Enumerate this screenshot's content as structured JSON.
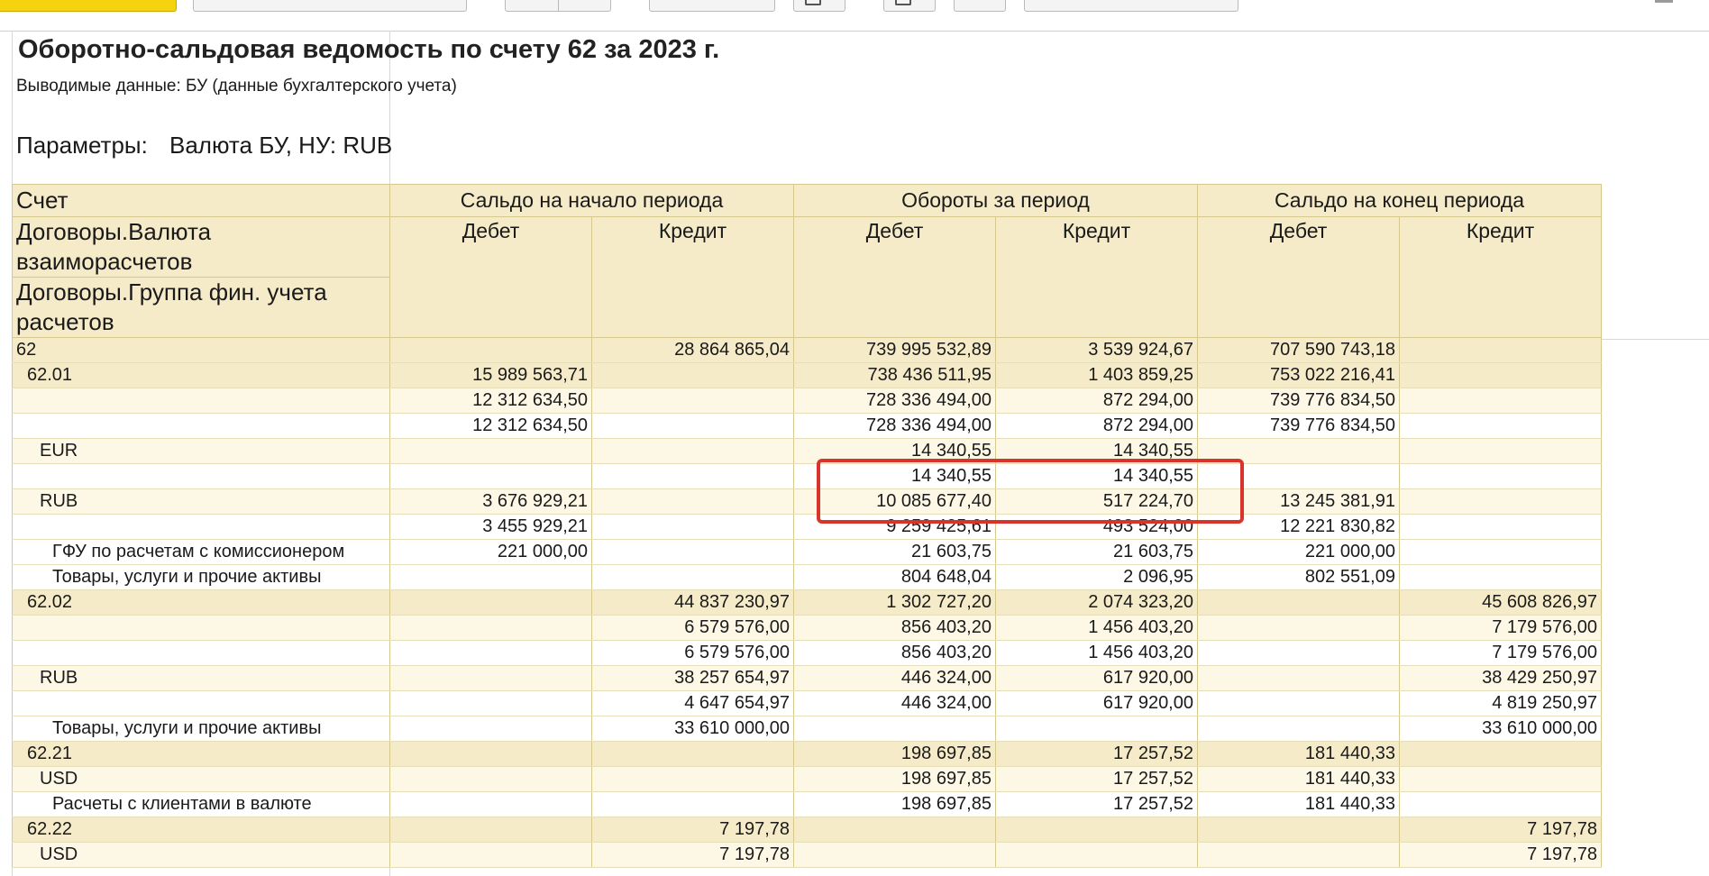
{
  "report": {
    "title": "Оборотно-сальдовая ведомость по счету 62 за 2023 г.",
    "subtitle": "Выводимые данные: БУ (данные бухгалтерского учета)",
    "params_label": "Параметры:",
    "params_value": "Валюта БУ, НУ: RUB"
  },
  "table": {
    "col_account": "Счет",
    "group_labels": [
      "Договоры.Валюта взаиморасчетов",
      "Договоры.Группа фин. учета расчетов"
    ],
    "col_opening": "Сальдо на начало периода",
    "col_turnover": "Обороты за период",
    "col_closing": "Сальдо на конец периода",
    "debit": "Дебет",
    "credit": "Кредит",
    "rows": [
      {
        "label": "62",
        "open_d": "",
        "open_c": "28 864 865,04",
        "turn_d": "739 995 532,89",
        "turn_c": "3 539 924,67",
        "close_d": "707 590 743,18",
        "close_c": ""
      },
      {
        "label": "62.01",
        "open_d": "15 989 563,71",
        "open_c": "",
        "turn_d": "738 436 511,95",
        "turn_c": "1 403 859,25",
        "close_d": "753 022 216,41",
        "close_c": ""
      },
      {
        "label": "",
        "open_d": "12 312 634,50",
        "open_c": "",
        "turn_d": "728 336 494,00",
        "turn_c": "872 294,00",
        "close_d": "739 776 834,50",
        "close_c": ""
      },
      {
        "label": "",
        "open_d": "12 312 634,50",
        "open_c": "",
        "turn_d": "728 336 494,00",
        "turn_c": "872 294,00",
        "close_d": "739 776 834,50",
        "close_c": ""
      },
      {
        "label": "EUR",
        "open_d": "",
        "open_c": "",
        "turn_d": "14 340,55",
        "turn_c": "14 340,55",
        "close_d": "",
        "close_c": ""
      },
      {
        "label": "",
        "open_d": "",
        "open_c": "",
        "turn_d": "14 340,55",
        "turn_c": "14 340,55",
        "close_d": "",
        "close_c": ""
      },
      {
        "label": "RUB",
        "open_d": "3 676 929,21",
        "open_c": "",
        "turn_d": "10 085 677,40",
        "turn_c": "517 224,70",
        "close_d": "13 245 381,91",
        "close_c": ""
      },
      {
        "label": "",
        "open_d": "3 455 929,21",
        "open_c": "",
        "turn_d": "9 259 425,61",
        "turn_c": "493 524,00",
        "close_d": "12 221 830,82",
        "close_c": ""
      },
      {
        "label": "ГФУ по расчетам с комиссионером",
        "open_d": "221 000,00",
        "open_c": "",
        "turn_d": "21 603,75",
        "turn_c": "21 603,75",
        "close_d": "221 000,00",
        "close_c": ""
      },
      {
        "label": "Товары, услуги и прочие активы",
        "open_d": "",
        "open_c": "",
        "turn_d": "804 648,04",
        "turn_c": "2 096,95",
        "close_d": "802 551,09",
        "close_c": ""
      },
      {
        "label": "62.02",
        "open_d": "",
        "open_c": "44 837 230,97",
        "turn_d": "1 302 727,20",
        "turn_c": "2 074 323,20",
        "close_d": "",
        "close_c": "45 608 826,97"
      },
      {
        "label": "",
        "open_d": "",
        "open_c": "6 579 576,00",
        "turn_d": "856 403,20",
        "turn_c": "1 456 403,20",
        "close_d": "",
        "close_c": "7 179 576,00"
      },
      {
        "label": "",
        "open_d": "",
        "open_c": "6 579 576,00",
        "turn_d": "856 403,20",
        "turn_c": "1 456 403,20",
        "close_d": "",
        "close_c": "7 179 576,00"
      },
      {
        "label": "RUB",
        "open_d": "",
        "open_c": "38 257 654,97",
        "turn_d": "446 324,00",
        "turn_c": "617 920,00",
        "close_d": "",
        "close_c": "38 429 250,97"
      },
      {
        "label": "",
        "open_d": "",
        "open_c": "4 647 654,97",
        "turn_d": "446 324,00",
        "turn_c": "617 920,00",
        "close_d": "",
        "close_c": "4 819 250,97"
      },
      {
        "label": "Товары, услуги и прочие активы",
        "open_d": "",
        "open_c": "33 610 000,00",
        "turn_d": "",
        "turn_c": "",
        "close_d": "",
        "close_c": "33 610 000,00"
      },
      {
        "label": "62.21",
        "open_d": "",
        "open_c": "",
        "turn_d": "198 697,85",
        "turn_c": "17 257,52",
        "close_d": "181 440,33",
        "close_c": ""
      },
      {
        "label": "USD",
        "open_d": "",
        "open_c": "",
        "turn_d": "198 697,85",
        "turn_c": "17 257,52",
        "close_d": "181 440,33",
        "close_c": ""
      },
      {
        "label": "Расчеты с клиентами в валюте",
        "open_d": "",
        "open_c": "",
        "turn_d": "198 697,85",
        "turn_c": "17 257,52",
        "close_d": "181 440,33",
        "close_c": ""
      },
      {
        "label": "62.22",
        "open_d": "",
        "open_c": "7 197,78",
        "turn_d": "",
        "turn_c": "",
        "close_d": "",
        "close_c": "7 197,78"
      },
      {
        "label": "USD",
        "open_d": "",
        "open_c": "7 197,78",
        "turn_d": "",
        "turn_c": "",
        "close_d": "",
        "close_c": "7 197,78"
      }
    ]
  },
  "annotation": {
    "color": "#d9342b",
    "target": "EUR turnover rows"
  }
}
